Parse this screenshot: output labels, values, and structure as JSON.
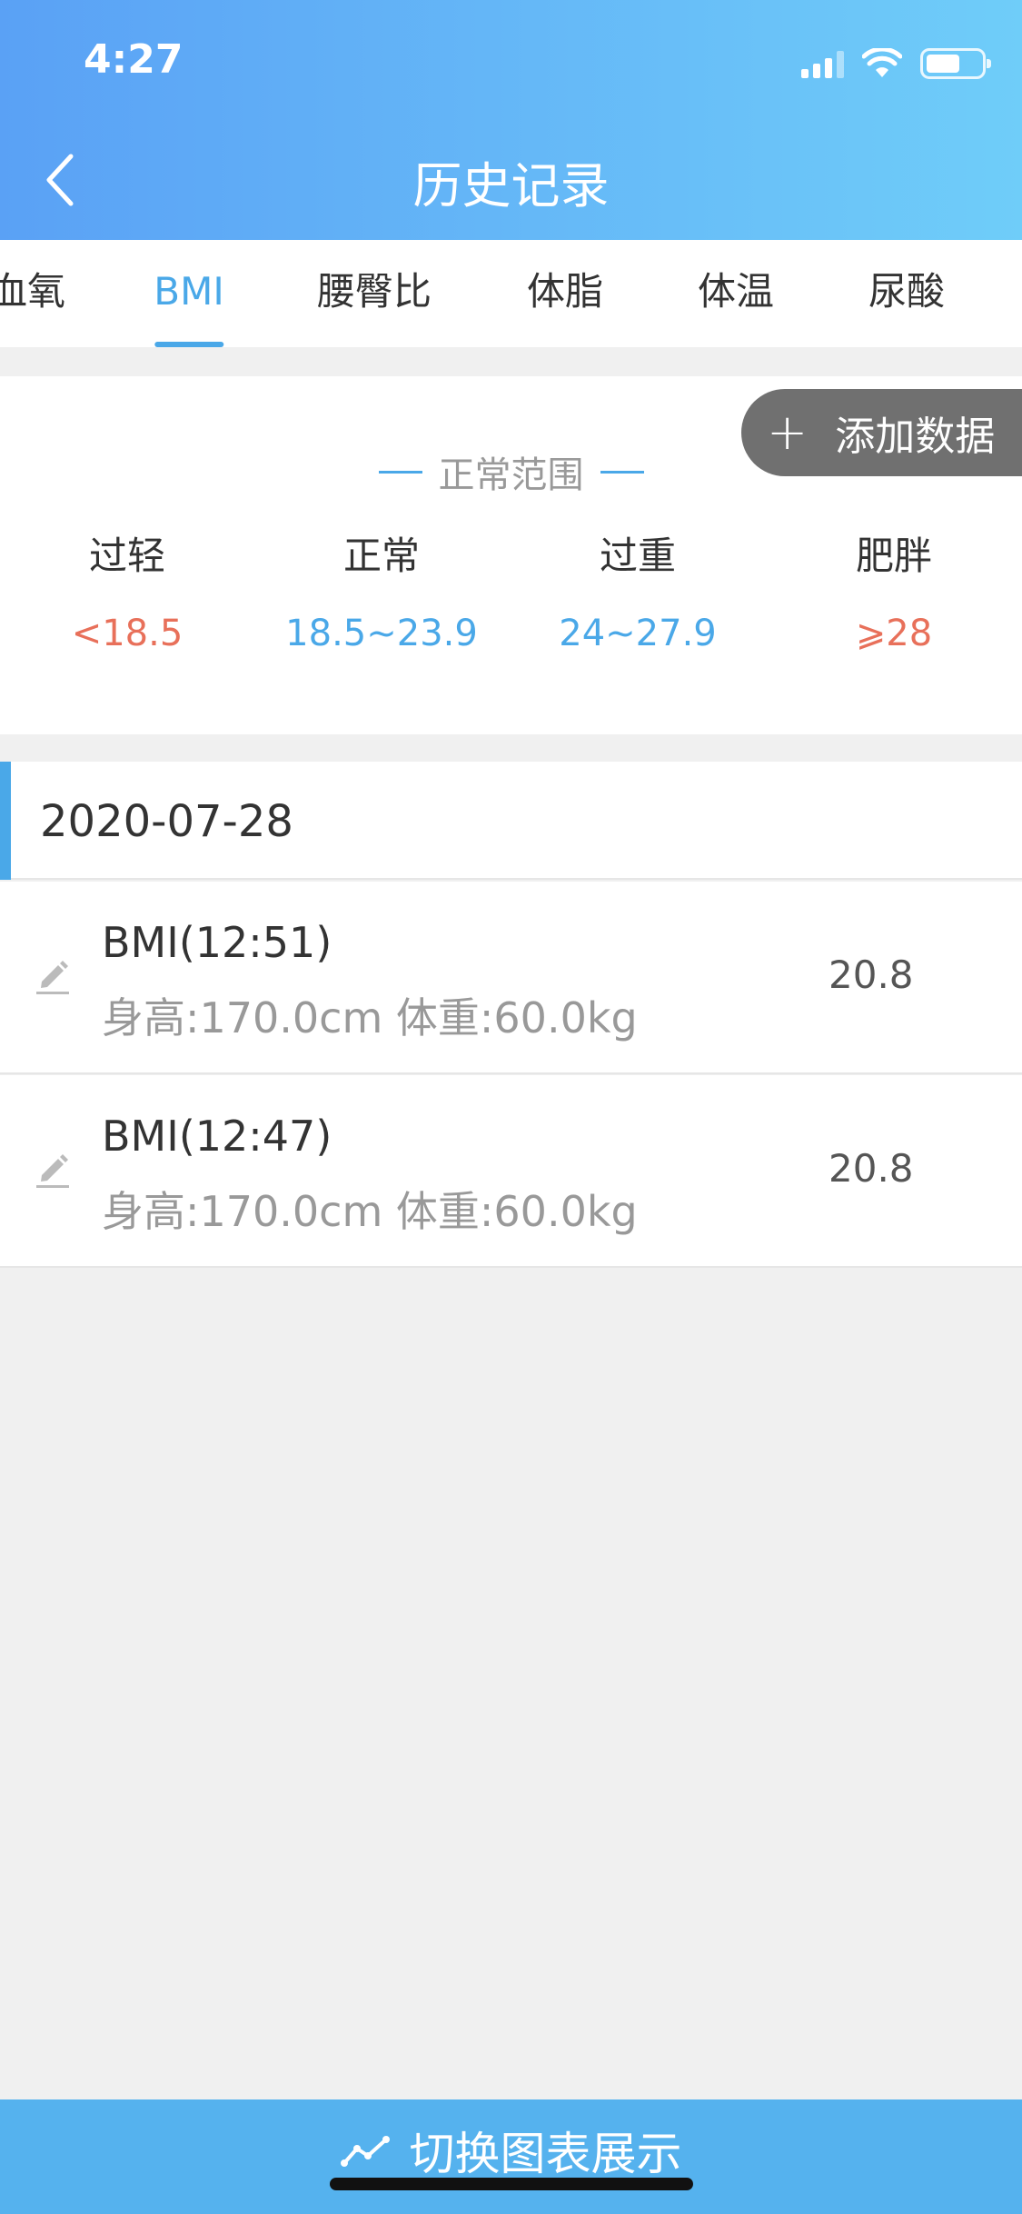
{
  "status_bar": {
    "time": "4:27"
  },
  "nav": {
    "title": "历史记录"
  },
  "tabs": [
    {
      "label": "血氧"
    },
    {
      "label": "BMI",
      "active": true
    },
    {
      "label": "腰臀比"
    },
    {
      "label": "体脂"
    },
    {
      "label": "体温"
    },
    {
      "label": "尿酸"
    }
  ],
  "add_button": {
    "label": "添加数据"
  },
  "range": {
    "title": "正常范围",
    "items": [
      {
        "label": "过轻",
        "value": "<18.5",
        "color": "#e8705a"
      },
      {
        "label": "正常",
        "value": "18.5~23.9",
        "color": "#4aa8e8"
      },
      {
        "label": "过重",
        "value": "24~27.9",
        "color": "#4aa8e8"
      },
      {
        "label": "肥胖",
        "value": "⩾28",
        "color": "#e8705a"
      }
    ]
  },
  "records_section": {
    "date": "2020-07-28",
    "records": [
      {
        "title": "BMI(12:51)",
        "detail": "身高:170.0cm 体重:60.0kg",
        "value": "20.8"
      },
      {
        "title": "BMI(12:47)",
        "detail": "身高:170.0cm 体重:60.0kg",
        "value": "20.8"
      }
    ]
  },
  "bottom_bar": {
    "label": "切换图表展示"
  },
  "colors": {
    "accent": "#4aa8e8",
    "warn": "#e8705a",
    "header_start": "#5aa1f5",
    "header_end": "#6fcdf9"
  }
}
